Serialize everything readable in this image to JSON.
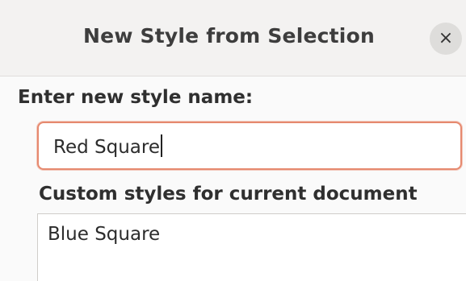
{
  "dialog": {
    "title": "New Style from Selection",
    "close_glyph": "×"
  },
  "form": {
    "name_label": "Enter new style name:",
    "name_value": "Red Square",
    "custom_styles_label": "Custom styles for current document",
    "custom_styles": [
      "Blue Square"
    ]
  },
  "colors": {
    "focus_border": "#e6896f",
    "background": "#f6f5f4"
  },
  "icons": {
    "close": "close-icon"
  }
}
